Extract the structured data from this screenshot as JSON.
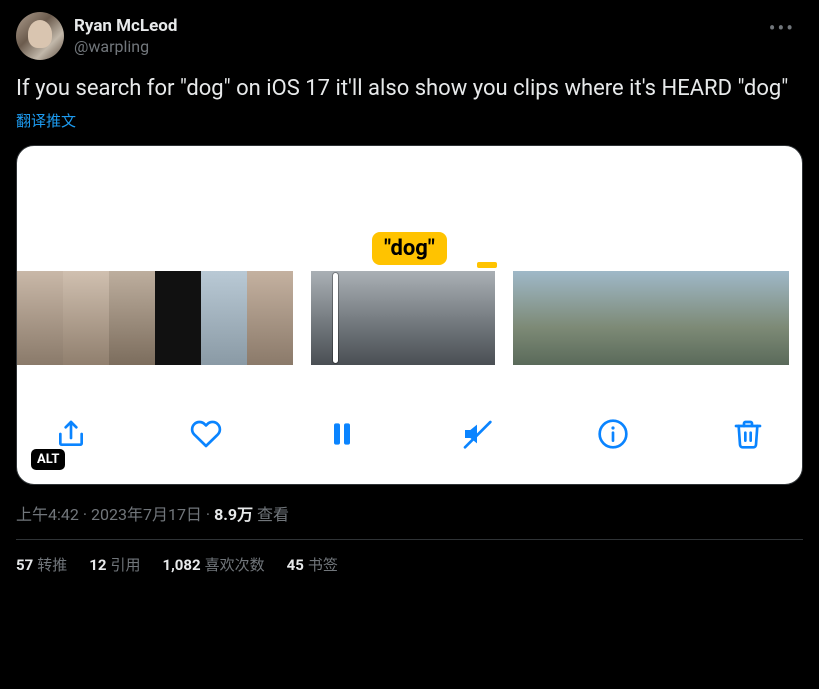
{
  "author": {
    "display_name": "Ryan McLeod",
    "handle": "@warpling"
  },
  "tweet_text": "If you search for \"dog\" on iOS 17 it'll also show you clips where it's HEARD \"dog\"",
  "translate_label": "翻译推文",
  "media": {
    "search_token": "\"dog\"",
    "alt_badge": "ALT"
  },
  "meta": {
    "time": "上午4:42",
    "date": "2023年7月17日",
    "views_number": "8.9万",
    "views_label": "查看"
  },
  "stats": {
    "retweets_num": "57",
    "retweets_label": "转推",
    "quotes_num": "12",
    "quotes_label": "引用",
    "likes_num": "1,082",
    "likes_label": "喜欢次数",
    "bookmarks_num": "45",
    "bookmarks_label": "书签"
  }
}
